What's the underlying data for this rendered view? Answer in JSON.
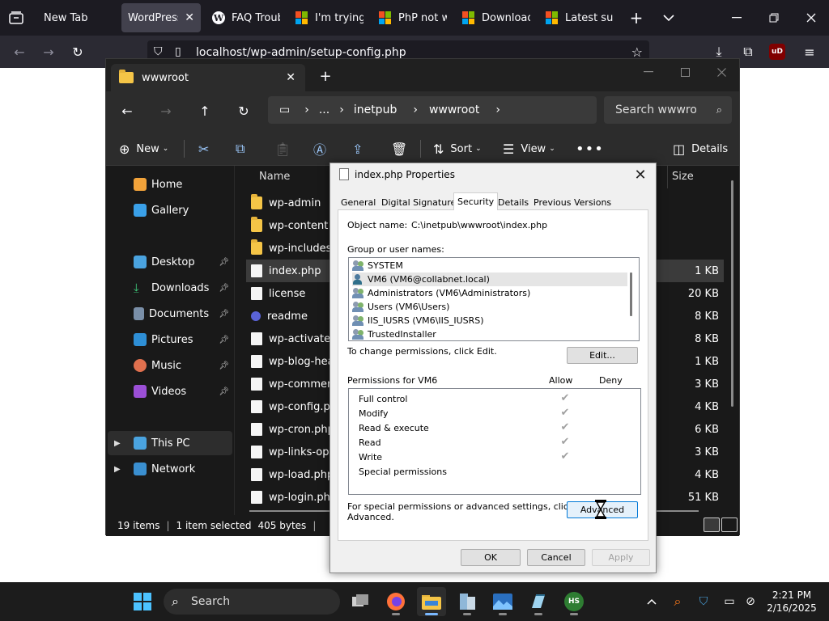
{
  "browser": {
    "tabs": [
      {
        "label": "New Tab"
      },
      {
        "label": "WordPress ›",
        "active": true
      },
      {
        "label": "FAQ Troubl"
      },
      {
        "label": "I'm trying t"
      },
      {
        "label": "PhP not wo"
      },
      {
        "label": "Download"
      },
      {
        "label": "Latest supp"
      }
    ],
    "url": "localhost/wp-admin/setup-config.php"
  },
  "explorer": {
    "tab_title": "wwwroot",
    "breadcrumb": [
      "...",
      "inetpub",
      "wwwroot"
    ],
    "search_placeholder": "Search wwwroot",
    "commands": {
      "new": "New",
      "sort": "Sort",
      "view": "View",
      "details": "Details"
    },
    "nav": {
      "home": "Home",
      "gallery": "Gallery",
      "desktop": "Desktop",
      "downloads": "Downloads",
      "documents": "Documents",
      "pictures": "Pictures",
      "music": "Music",
      "videos": "Videos",
      "this_pc": "This PC",
      "network": "Network"
    },
    "columns": {
      "name": "Name",
      "size": "Size"
    },
    "files": [
      {
        "name": "wp-admin",
        "size": "",
        "type": "folder"
      },
      {
        "name": "wp-content",
        "size": "",
        "type": "folder"
      },
      {
        "name": "wp-includes",
        "size": "",
        "type": "folder"
      },
      {
        "name": "index.php",
        "size": "1 KB",
        "type": "doc",
        "selected": true
      },
      {
        "name": "license",
        "size": "20 KB",
        "type": "doc"
      },
      {
        "name": "readme",
        "size": "8 KB",
        "type": "readme"
      },
      {
        "name": "wp-activate.php",
        "size": "8 KB",
        "type": "doc"
      },
      {
        "name": "wp-blog-header.php",
        "size": "1 KB",
        "type": "doc"
      },
      {
        "name": "wp-comments-post.php",
        "size": "3 KB",
        "type": "doc"
      },
      {
        "name": "wp-config.php",
        "size": "4 KB",
        "type": "doc"
      },
      {
        "name": "wp-cron.php",
        "size": "6 KB",
        "type": "doc"
      },
      {
        "name": "wp-links-opml.php",
        "size": "3 KB",
        "type": "doc"
      },
      {
        "name": "wp-load.php",
        "size": "4 KB",
        "type": "doc"
      },
      {
        "name": "wp-login.php",
        "size": "51 KB",
        "type": "doc"
      }
    ],
    "status": {
      "items": "19 items",
      "selected": "1 item selected",
      "bytes": "405 bytes"
    }
  },
  "dialog": {
    "title": "index.php Properties",
    "tabs": [
      "General",
      "Digital Signatures",
      "Security",
      "Details",
      "Previous Versions"
    ],
    "active_tab": "Security",
    "object_name_label": "Object name:",
    "object_name_value": "C:\\inetpub\\wwwroot\\index.php",
    "group_label": "Group or user names:",
    "groups": [
      {
        "name": "SYSTEM",
        "icon": "group-icon"
      },
      {
        "name": "VM6 (VM6@collabnet.local)",
        "icon": "user-icon",
        "selected": true
      },
      {
        "name": "Administrators (VM6\\Administrators)",
        "icon": "group-icon"
      },
      {
        "name": "Users (VM6\\Users)",
        "icon": "group-icon"
      },
      {
        "name": "IIS_IUSRS (VM6\\IIS_IUSRS)",
        "icon": "group-icon"
      },
      {
        "name": "TrustedInstaller",
        "icon": "group-icon"
      }
    ],
    "change_hint": "To change permissions, click Edit.",
    "edit_button": "Edit...",
    "permissions_label": "Permissions for VM6",
    "allow_header": "Allow",
    "deny_header": "Deny",
    "permissions": [
      {
        "name": "Full control",
        "allow": true,
        "deny": false
      },
      {
        "name": "Modify",
        "allow": true,
        "deny": false
      },
      {
        "name": "Read & execute",
        "allow": true,
        "deny": false
      },
      {
        "name": "Read",
        "allow": true,
        "deny": false
      },
      {
        "name": "Write",
        "allow": true,
        "deny": false
      },
      {
        "name": "Special permissions",
        "allow": false,
        "deny": false
      }
    ],
    "advanced_hint_line1": "For special permissions or advanced settings, click",
    "advanced_hint_line2": "Advanced.",
    "advanced_button": "Advanced",
    "ok": "OK",
    "cancel": "Cancel",
    "apply": "Apply"
  },
  "taskbar": {
    "search": "Search",
    "time": "2:21 PM",
    "date": "2/16/2025"
  }
}
